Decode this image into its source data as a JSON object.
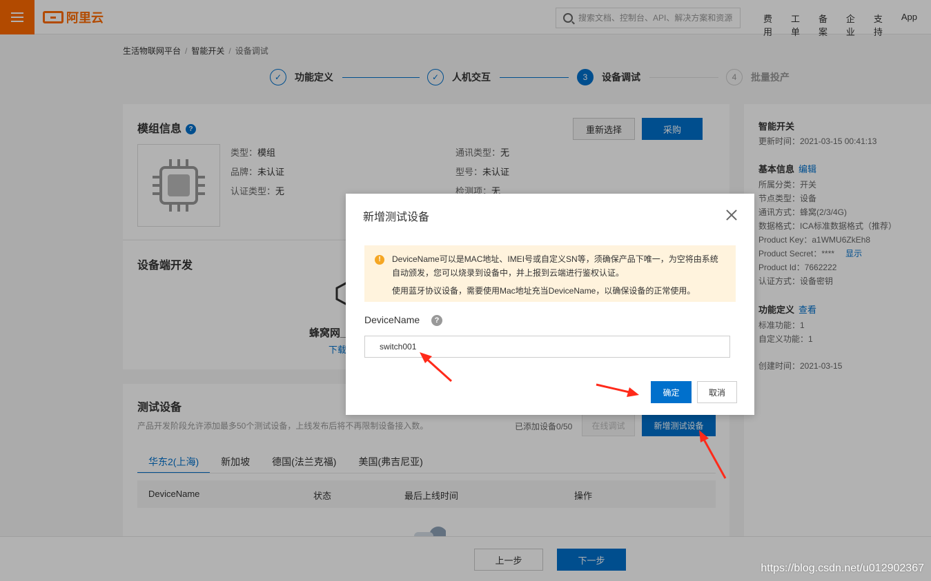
{
  "topbar": {
    "logo_text": "阿里云",
    "search_placeholder": "搜索文档、控制台、API、解决方案和资源",
    "nav": [
      "费用",
      "工单",
      "备案",
      "企业",
      "支持",
      "App"
    ],
    "brand_color": "#ff6a00"
  },
  "breadcrumb": [
    "生活物联网平台",
    "智能开关",
    "设备调试"
  ],
  "steps": [
    {
      "label": "功能定义",
      "state": "done"
    },
    {
      "label": "人机交互",
      "state": "done"
    },
    {
      "label": "设备调试",
      "state": "active",
      "num": "3"
    },
    {
      "label": "批量投产",
      "state": "todo",
      "num": "4"
    }
  ],
  "module": {
    "title": "模组信息",
    "reselect_label": "重新选择",
    "buy_label": "采购",
    "fields": [
      {
        "k": "类型：",
        "v": "模组"
      },
      {
        "k": "品牌：",
        "v": "未认证"
      },
      {
        "k": "认证类型：",
        "v": "无"
      },
      {
        "k": "通讯类型：",
        "v": "无"
      },
      {
        "k": "型号：",
        "v": "未认证"
      },
      {
        "k": "检测项：",
        "v": "无"
      }
    ]
  },
  "dev": {
    "title": "设备端开发",
    "subtitle": "蜂窝网_",
    "link": "下载"
  },
  "test": {
    "title": "测试设备",
    "desc": "产品开发阶段允许添加最多50个测试设备，上线发布后将不再限制设备接入数。",
    "count_text": "已添加设备0/50",
    "online_debug_label": "在线调试",
    "add_label": "新增测试设备",
    "tabs": [
      "华东2(上海)",
      "新加坡",
      "德国(法兰克福)",
      "美国(弗吉尼亚)"
    ],
    "columns": [
      "DeviceName",
      "状态",
      "最后上线时间",
      "操作"
    ]
  },
  "side": {
    "product_name": "智能开关",
    "update_time": "更新时间：2021-03-15 00:41:13",
    "basic_title": "基本信息",
    "edit_label": "编辑",
    "rows": [
      "所属分类：开关",
      "节点类型：设备",
      "通讯方式：蜂窝(2/3/4G)",
      "数据格式：ICA标准数据格式（推荐）",
      "Product Key：a1WMU6ZkEh8",
      "Product Secret：****",
      "Product Id：7662222",
      "认证方式：设备密钥"
    ],
    "show_label": "显示",
    "func_title": "功能定义",
    "view_label": "查看",
    "func_rows": [
      "标准功能：1",
      "自定义功能：1"
    ],
    "created": "创建时间：2021-03-15"
  },
  "bottom": {
    "prev_label": "上一步",
    "next_label": "下一步"
  },
  "dialog": {
    "title": "新增测试设备",
    "notice_1": "DeviceName可以是MAC地址、IMEI号或自定义SN等，须确保产品下唯一，为空将由系统自动颁发，您可以烧录到设备中，并上报到云端进行鉴权认证。",
    "notice_2": "使用蓝牙协议设备，需要使用Mac地址充当DeviceName，以确保设备的正常使用。",
    "field_label": "DeviceName",
    "field_value": "switch001",
    "ok_label": "确定",
    "cancel_label": "取消"
  },
  "watermark": "https://blog.csdn.net/u012902367"
}
